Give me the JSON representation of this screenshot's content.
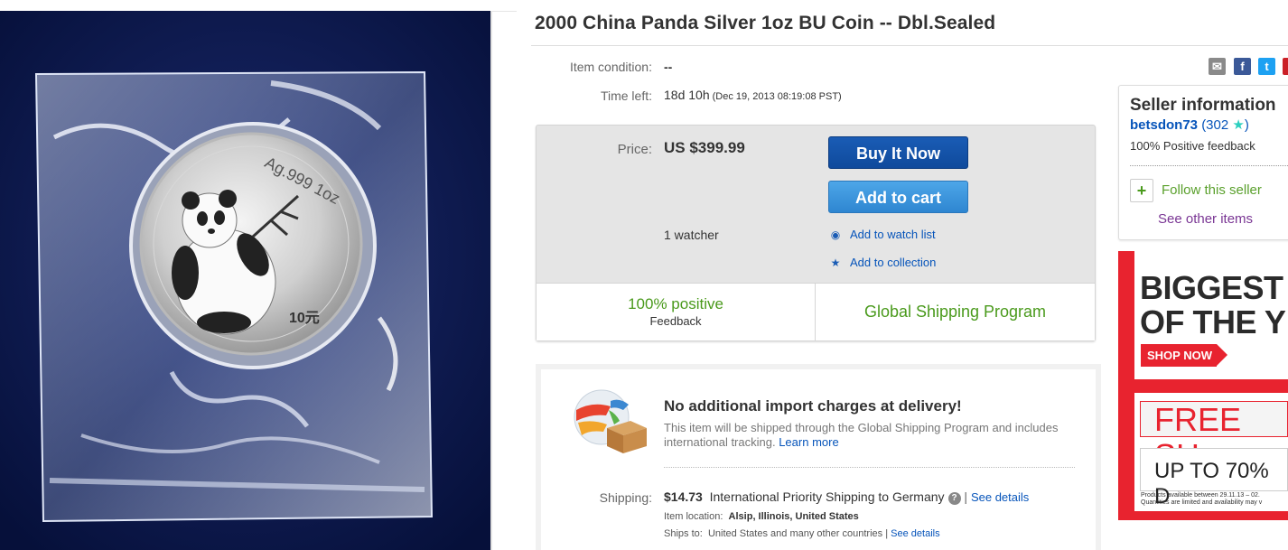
{
  "listing": {
    "title": "2000 China Panda Silver 1oz BU Coin -- Dbl.Sealed",
    "condition_label": "Item condition:",
    "condition_value": "--",
    "time_left_label": "Time left:",
    "time_left_value": "18d 10h",
    "time_left_end": "(Dec 19, 2013  08:19:08 PST)"
  },
  "coin": {
    "inscription_top": "Ag.999 1oz",
    "denomination": "10元"
  },
  "share_icons": [
    "mail-icon",
    "facebook-icon",
    "twitter-icon",
    "pinterest-icon"
  ],
  "buy_box": {
    "price_label": "Price:",
    "price_value": "US $399.99",
    "buy_it_now": "Buy It Now",
    "add_to_cart": "Add to cart",
    "watchers": "1 watcher",
    "add_to_watch_list": "Add to watch list",
    "add_to_collection": "Add to collection",
    "positive_pct": "100% positive",
    "feedback": "Feedback",
    "global_shipping": "Global Shipping Program"
  },
  "shipping": {
    "headline": "No additional import charges at delivery!",
    "desc": "This item will be shipped through the Global Shipping Program and includes international tracking.",
    "learn_more": "Learn more",
    "shipping_label": "Shipping:",
    "price": "$14.73",
    "method": "International Priority Shipping to Germany",
    "see_details": "See details",
    "item_location_label": "Item location:",
    "item_location_value": "Alsip, Illinois, United States",
    "ships_to_label": "Ships to:",
    "ships_to_value": "United States and many other countries",
    "ships_to_link": "See details"
  },
  "seller": {
    "title": "Seller information",
    "name": "betsdon73",
    "score_open": "(302",
    "score_close": ")",
    "feedback": "100% Positive feedback",
    "follow": "Follow this seller",
    "see_other": "See other items"
  },
  "ad": {
    "line1": "BIGGEST",
    "line2": "OF THE Y",
    "shop_now": "SHOP NOW",
    "free": "FREE SH",
    "upto": "UP TO 70% D",
    "fine1": "Products available between   29.11.13 – 02.",
    "fine2": "Quantities are limited and availability may v"
  },
  "colors": {
    "brand_blue": "#0654ba",
    "buy_button": "#1a5cb5",
    "cart_button": "#3a95dc",
    "positive_green": "#4a9a1c",
    "ad_red": "#e8232f"
  }
}
